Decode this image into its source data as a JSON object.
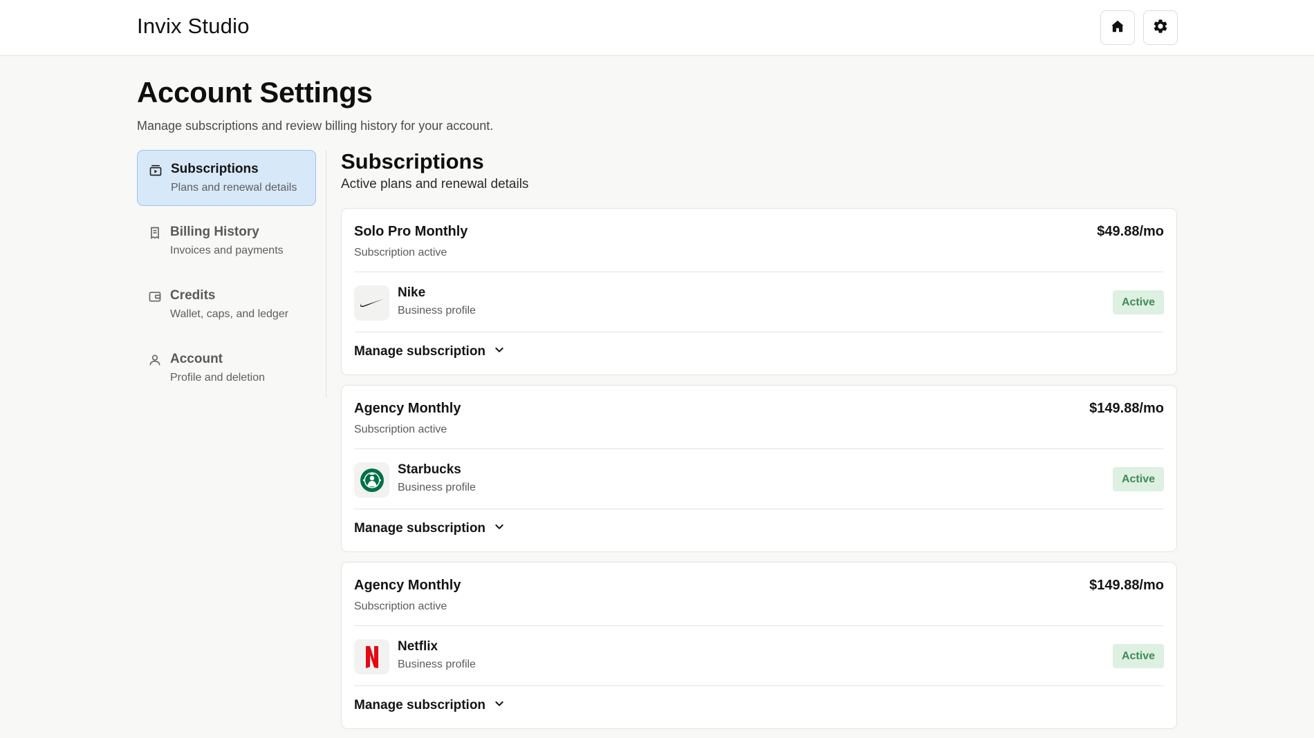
{
  "app": {
    "brand": "Invix Studio"
  },
  "header": {
    "icons": [
      {
        "name": "home-icon"
      },
      {
        "name": "gear-icon"
      }
    ]
  },
  "page": {
    "title": "Account Settings",
    "subtitle": "Manage subscriptions and review billing history for your account."
  },
  "sidebar": {
    "items": [
      {
        "title": "Subscriptions",
        "desc": "Plans and renewal details",
        "icon": "subscriptions-icon",
        "active": true
      },
      {
        "title": "Billing History",
        "desc": "Invoices and payments",
        "icon": "receipt-icon",
        "active": false
      },
      {
        "title": "Credits",
        "desc": "Wallet, caps, and ledger",
        "icon": "wallet-icon",
        "active": false
      },
      {
        "title": "Account",
        "desc": "Profile and deletion",
        "icon": "user-icon",
        "active": false
      }
    ]
  },
  "section": {
    "title": "Subscriptions",
    "subtitle": "Active plans and renewal details"
  },
  "subscriptions": [
    {
      "plan": "Solo Pro Monthly",
      "status": "Subscription active",
      "price": "$49.88/mo",
      "business": "Nike",
      "business_type": "Business profile",
      "badge": "Active",
      "manage_label": "Manage subscription",
      "logo": "nike-logo"
    },
    {
      "plan": "Agency Monthly",
      "status": "Subscription active",
      "price": "$149.88/mo",
      "business": "Starbucks",
      "business_type": "Business profile",
      "badge": "Active",
      "manage_label": "Manage subscription",
      "logo": "starbucks-logo"
    },
    {
      "plan": "Agency Monthly",
      "status": "Subscription active",
      "price": "$149.88/mo",
      "business": "Netflix",
      "business_type": "Business profile",
      "badge": "Active",
      "manage_label": "Manage subscription",
      "logo": "netflix-logo"
    }
  ],
  "colors": {
    "active_nav_bg": "#d7e8f9",
    "active_nav_border": "#9dc3e9",
    "badge_bg": "#ddf0e1",
    "badge_text": "#3f8a57",
    "netflix_red": "#e50914",
    "starbucks_green": "#00704a"
  }
}
